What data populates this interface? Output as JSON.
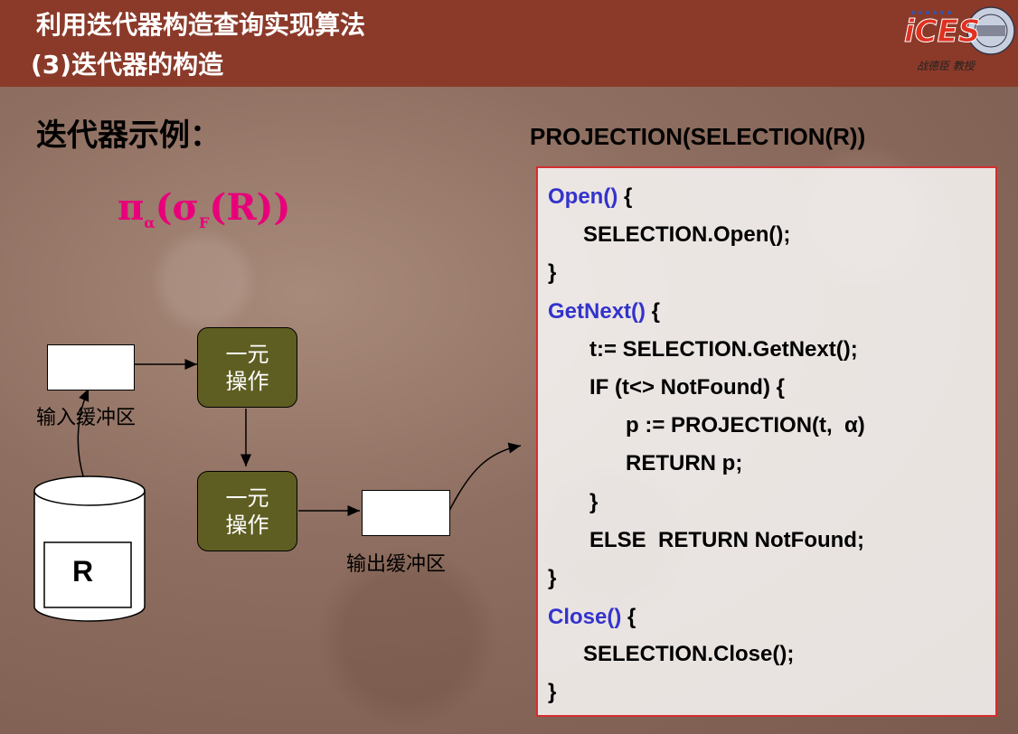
{
  "header": {
    "title_line1": "利用迭代器构造查询实现算法",
    "title_line2": "(3)迭代器的构造",
    "logo_text": "iCES",
    "logo_caption": "战德臣 教授"
  },
  "example_heading": "迭代器示例：",
  "formula": {
    "pi": "π",
    "pi_sub": "α",
    "open": "(",
    "sigma": "σ",
    "sigma_sub": "F",
    "inner": "(R))"
  },
  "diagram": {
    "input_buffer_label": "输入缓冲区",
    "output_buffer_label": "输出缓冲区",
    "op1_line1": "一元",
    "op1_line2": "操作",
    "op2_line1": "一元",
    "op2_line2": "操作",
    "table_label": "R"
  },
  "code": {
    "title": "PROJECTION(SELECTION(R))",
    "open_kw": "Open()",
    "open_brace": " {",
    "l2": "SELECTION.Open();",
    "l3": "}",
    "getnext_kw": "GetNext()",
    "getnext_brace": " {",
    "l5": "t:= SELECTION.GetNext();",
    "l6": "IF (t<> NotFound) {",
    "l7": "p := PROJECTION(t,  α)",
    "l8": "RETURN p;",
    "l9": "}",
    "l10": "ELSE  RETURN NotFound;",
    "l11": "}",
    "close_kw": "Close()",
    "close_brace": " {",
    "l13": "SELECTION.Close();",
    "l14": "}"
  }
}
